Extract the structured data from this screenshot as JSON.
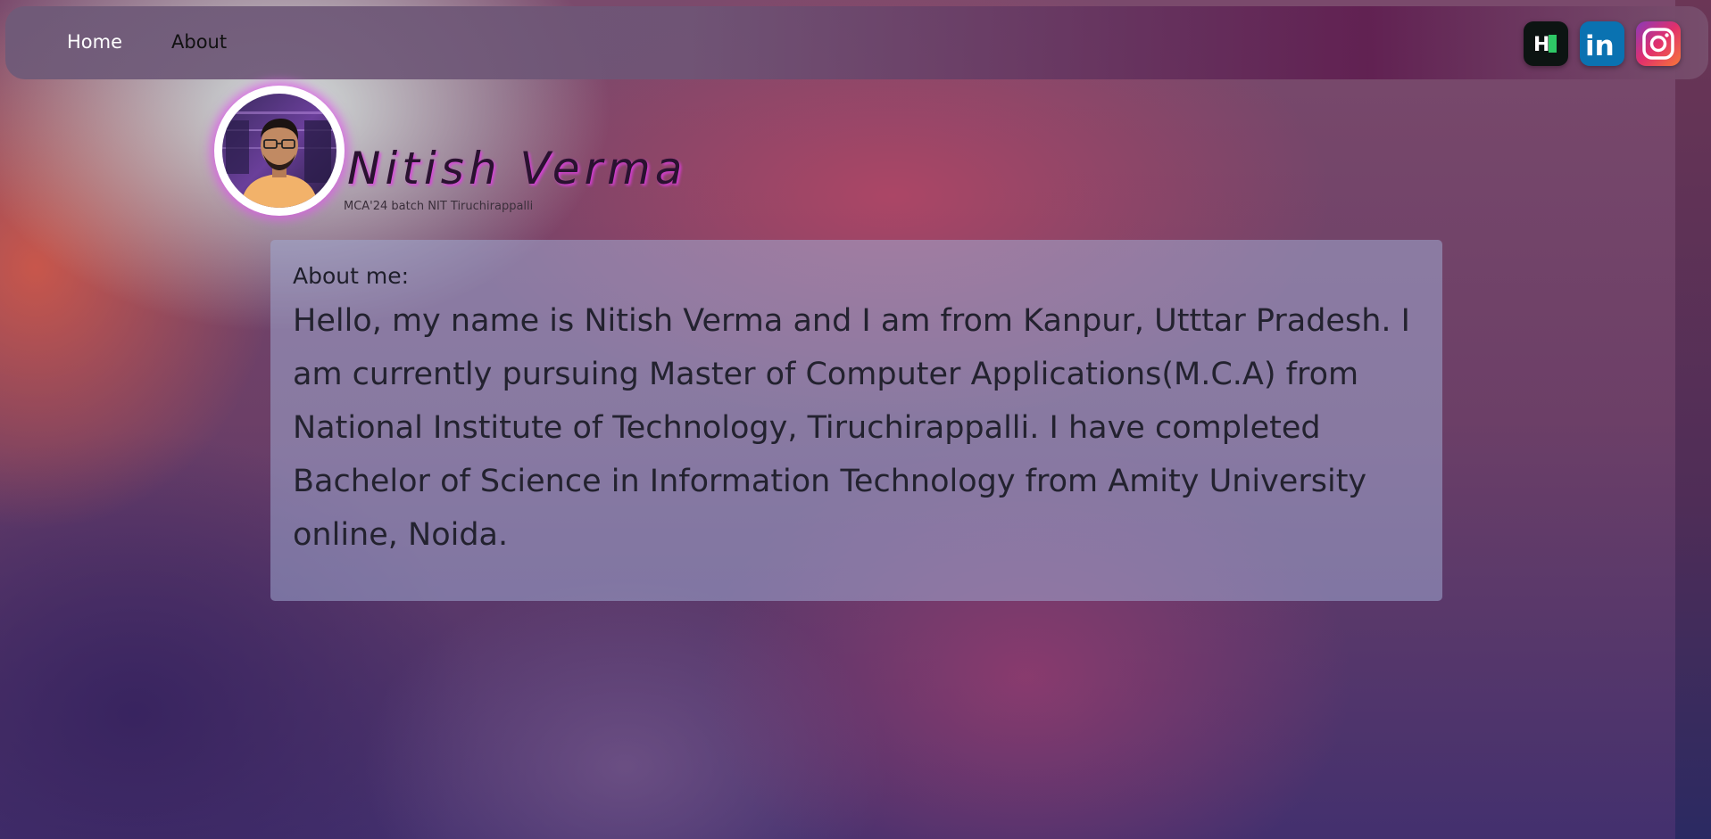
{
  "nav": {
    "links": [
      {
        "label": "Home"
      },
      {
        "label": "About"
      }
    ],
    "social": [
      {
        "name": "hackerrank",
        "label": "H",
        "color": "#0c1412"
      },
      {
        "name": "linkedin",
        "label": "in",
        "color": "#0a72b1"
      },
      {
        "name": "instagram",
        "label": "",
        "color": "#e1306c"
      }
    ]
  },
  "profile": {
    "name": "Nitish Verma",
    "subtitle": "MCA'24 batch NIT Tiruchirappalli"
  },
  "about": {
    "heading": "About me:",
    "body": "Hello, my name is Nitish Verma and I am from Kanpur, Utttar Pradesh. I am currently pursuing Master of Computer Applications(M.C.A) from National Institute of Technology, Tiruchirappalli. I have completed Bachelor of Science in Information Technology from Amity University online, Noida."
  },
  "colors": {
    "name_glow": "#e13ce6",
    "avatar_ring_glow": "#dc5ae6"
  }
}
